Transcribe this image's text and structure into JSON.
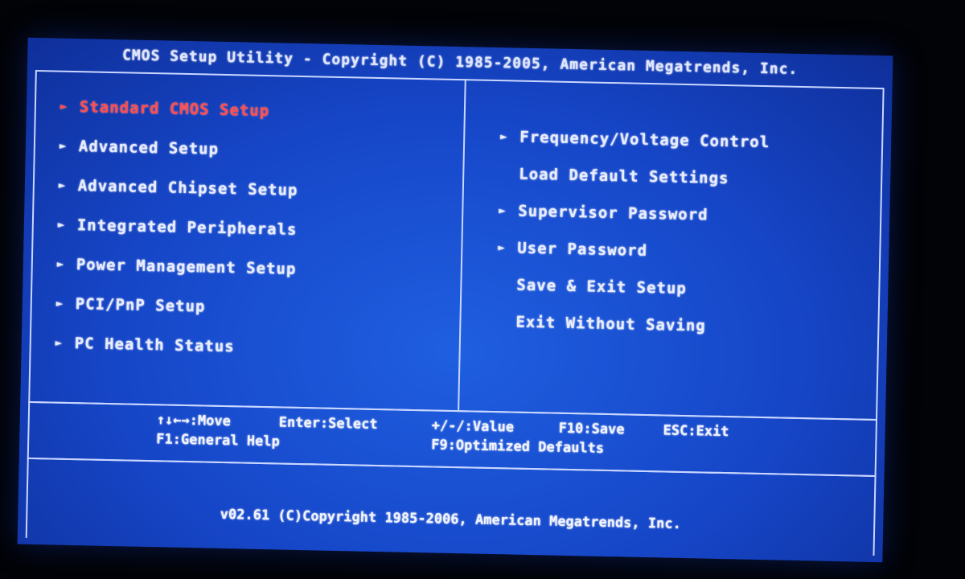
{
  "header": {
    "title": "CMOS Setup Utility - Copyright (C) 1985-2005, American Megatrends, Inc."
  },
  "left_menu": [
    {
      "label": "Standard CMOS Setup",
      "arrow": "►",
      "selected": true
    },
    {
      "label": "Advanced Setup",
      "arrow": "►",
      "selected": false
    },
    {
      "label": "Advanced Chipset Setup",
      "arrow": "►",
      "selected": false
    },
    {
      "label": "Integrated Peripherals",
      "arrow": "►",
      "selected": false
    },
    {
      "label": "Power Management Setup",
      "arrow": "►",
      "selected": false
    },
    {
      "label": "PCI/PnP Setup",
      "arrow": "►",
      "selected": false
    },
    {
      "label": "PC Health Status",
      "arrow": "►",
      "selected": false
    }
  ],
  "right_menu": [
    {
      "label": "Frequency/Voltage Control",
      "arrow": "►"
    },
    {
      "label": "Load Default Settings",
      "arrow": ""
    },
    {
      "label": "Supervisor Password",
      "arrow": "►"
    },
    {
      "label": "User Password",
      "arrow": "►"
    },
    {
      "label": "Save & Exit Setup",
      "arrow": ""
    },
    {
      "label": "Exit Without Saving",
      "arrow": ""
    }
  ],
  "help": {
    "move": "↑↓←→:Move",
    "select": "Enter:Select",
    "value": "+/-/:Value",
    "save": "F10:Save",
    "exit": "ESC:Exit",
    "general_help": "F1:General Help",
    "optimized_defaults": "F9:Optimized Defaults"
  },
  "footer": {
    "version": "v02.61 (C)Copyright 1985-2006, American Megatrends, Inc."
  },
  "colors": {
    "background": "#1646c8",
    "text": "#e8ecff",
    "selected": "#ff4d4d",
    "border": "#c9d6ff"
  }
}
